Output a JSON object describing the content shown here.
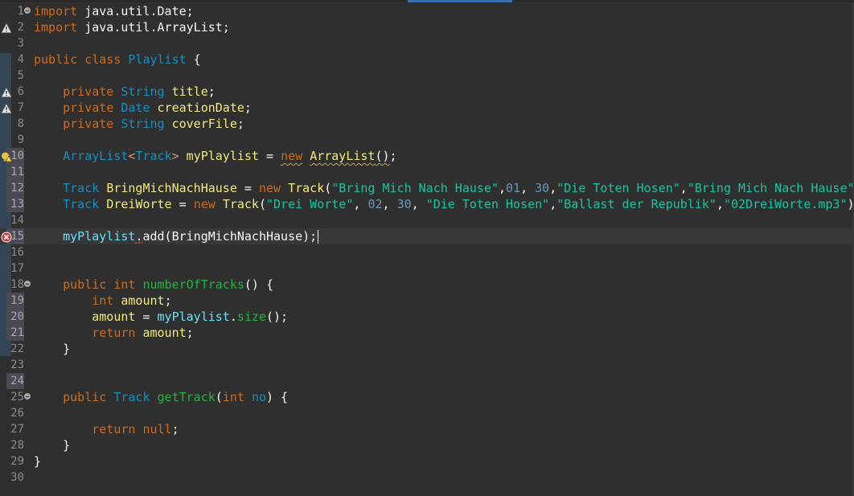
{
  "editor": {
    "language": "Java",
    "file_lines": [
      {
        "num": "1",
        "tokens": [
          [
            "k",
            "import"
          ],
          [
            "p",
            " java.util.Date;"
          ]
        ]
      },
      {
        "num": "2",
        "tokens": [
          [
            "k",
            "import"
          ],
          [
            "p",
            " java.util.ArrayList;"
          ]
        ]
      },
      {
        "num": "3",
        "tokens": []
      },
      {
        "num": "4",
        "tokens": [
          [
            "k",
            "public"
          ],
          [
            "p",
            " "
          ],
          [
            "k",
            "class"
          ],
          [
            "p",
            " "
          ],
          [
            "t",
            "Playlist"
          ],
          [
            "p",
            " {"
          ]
        ]
      },
      {
        "num": "5",
        "tokens": []
      },
      {
        "num": "6",
        "tokens": [
          [
            "p",
            "    "
          ],
          [
            "k",
            "private"
          ],
          [
            "p",
            " "
          ],
          [
            "t",
            "String"
          ],
          [
            "p",
            " "
          ],
          [
            "v",
            "title"
          ],
          [
            "p",
            ";"
          ]
        ]
      },
      {
        "num": "7",
        "tokens": [
          [
            "p",
            "    "
          ],
          [
            "k",
            "private"
          ],
          [
            "p",
            " "
          ],
          [
            "t",
            "Date"
          ],
          [
            "p",
            " "
          ],
          [
            "v",
            "creationDate"
          ],
          [
            "p",
            ";"
          ]
        ]
      },
      {
        "num": "8",
        "tokens": [
          [
            "p",
            "    "
          ],
          [
            "k",
            "private"
          ],
          [
            "p",
            " "
          ],
          [
            "t",
            "String"
          ],
          [
            "p",
            " "
          ],
          [
            "v",
            "coverFile"
          ],
          [
            "p",
            ";"
          ]
        ]
      },
      {
        "num": "9",
        "tokens": []
      },
      {
        "num": "10",
        "tokens": [
          [
            "p",
            "    "
          ],
          [
            "t",
            "ArrayList"
          ],
          [
            "g",
            "<"
          ],
          [
            "t",
            "Track"
          ],
          [
            "g",
            ">"
          ],
          [
            "p",
            " "
          ],
          [
            "v",
            "myPlaylist"
          ],
          [
            "p",
            " = "
          ],
          [
            "kw",
            "new"
          ],
          [
            "p",
            " "
          ],
          [
            "tw",
            "ArrayList"
          ],
          [
            "pw",
            "()"
          ],
          [
            "p",
            ";"
          ]
        ]
      },
      {
        "num": "11",
        "tokens": []
      },
      {
        "num": "12",
        "tokens": [
          [
            "p",
            "    "
          ],
          [
            "t",
            "Track"
          ],
          [
            "p",
            " "
          ],
          [
            "v",
            "BringMichNachHause"
          ],
          [
            "p",
            " = "
          ],
          [
            "k",
            "new"
          ],
          [
            "p",
            " "
          ],
          [
            "v",
            "Track"
          ],
          [
            "p",
            "("
          ],
          [
            "s",
            "\"Bring Mich Nach Hause\""
          ],
          [
            "p",
            ","
          ],
          [
            "n",
            "01"
          ],
          [
            "p",
            ", "
          ],
          [
            "n",
            "30"
          ],
          [
            "p",
            ","
          ],
          [
            "s",
            "\"Die Toten Hosen\""
          ],
          [
            "p",
            ","
          ],
          [
            "s",
            "\"Bring Mich Nach Hause\""
          ]
        ]
      },
      {
        "num": "13",
        "tokens": [
          [
            "p",
            "    "
          ],
          [
            "t",
            "Track"
          ],
          [
            "p",
            " "
          ],
          [
            "v",
            "DreiWorte"
          ],
          [
            "p",
            " = "
          ],
          [
            "k",
            "new"
          ],
          [
            "p",
            " "
          ],
          [
            "v",
            "Track"
          ],
          [
            "p",
            "("
          ],
          [
            "s",
            "\"Drei Worte\""
          ],
          [
            "p",
            ", "
          ],
          [
            "n",
            "02"
          ],
          [
            "p",
            ", "
          ],
          [
            "n",
            "30"
          ],
          [
            "p",
            ", "
          ],
          [
            "s",
            "\"Die Toten Hosen\""
          ],
          [
            "p",
            ","
          ],
          [
            "s",
            "\"Ballast der Republik\""
          ],
          [
            "p",
            ","
          ],
          [
            "s",
            "\"02DreiWorte.mp3\""
          ],
          [
            "p",
            ")"
          ]
        ]
      },
      {
        "num": "14",
        "tokens": []
      },
      {
        "num": "15",
        "tokens": [
          [
            "p",
            "    "
          ],
          [
            "f",
            "myPlaylist"
          ],
          [
            "e",
            "."
          ],
          [
            "p",
            "add(BringMichNachHause);"
          ]
        ]
      },
      {
        "num": "16",
        "tokens": []
      },
      {
        "num": "17",
        "tokens": []
      },
      {
        "num": "18",
        "tokens": [
          [
            "p",
            "    "
          ],
          [
            "k",
            "public"
          ],
          [
            "p",
            " "
          ],
          [
            "k",
            "int"
          ],
          [
            "p",
            " "
          ],
          [
            "m",
            "numberOfTracks"
          ],
          [
            "p",
            "() {"
          ]
        ]
      },
      {
        "num": "19",
        "tokens": [
          [
            "p",
            "        "
          ],
          [
            "k",
            "int"
          ],
          [
            "p",
            " "
          ],
          [
            "v",
            "amount"
          ],
          [
            "p",
            ";"
          ]
        ]
      },
      {
        "num": "20",
        "tokens": [
          [
            "p",
            "        "
          ],
          [
            "v",
            "amount"
          ],
          [
            "p",
            " = "
          ],
          [
            "f",
            "myPlaylist"
          ],
          [
            "p",
            "."
          ],
          [
            "m",
            "size"
          ],
          [
            "p",
            "();"
          ]
        ]
      },
      {
        "num": "21",
        "tokens": [
          [
            "p",
            "        "
          ],
          [
            "k",
            "return"
          ],
          [
            "p",
            " "
          ],
          [
            "v",
            "amount"
          ],
          [
            "p",
            ";"
          ]
        ]
      },
      {
        "num": "22",
        "tokens": [
          [
            "p",
            "    }"
          ]
        ]
      },
      {
        "num": "23",
        "tokens": []
      },
      {
        "num": "24",
        "tokens": []
      },
      {
        "num": "25",
        "tokens": [
          [
            "p",
            "    "
          ],
          [
            "k",
            "public"
          ],
          [
            "p",
            " "
          ],
          [
            "t",
            "Track"
          ],
          [
            "p",
            " "
          ],
          [
            "m",
            "getTrack"
          ],
          [
            "p",
            "("
          ],
          [
            "k",
            "int"
          ],
          [
            "p",
            " "
          ],
          [
            "t",
            "no"
          ],
          [
            "p",
            ") {"
          ]
        ]
      },
      {
        "num": "26",
        "tokens": []
      },
      {
        "num": "27",
        "tokens": [
          [
            "p",
            "        "
          ],
          [
            "k",
            "return"
          ],
          [
            "p",
            " "
          ],
          [
            "k",
            "null"
          ],
          [
            "p",
            ";"
          ]
        ]
      },
      {
        "num": "28",
        "tokens": [
          [
            "p",
            "    }"
          ]
        ]
      },
      {
        "num": "29",
        "tokens": [
          [
            "p",
            "}"
          ]
        ]
      },
      {
        "num": "30",
        "tokens": []
      }
    ],
    "fold_lines": [
      "1",
      "18",
      "25"
    ],
    "changed_lines": [
      "10",
      "11",
      "12",
      "13",
      "15",
      "19",
      "20",
      "21",
      "24"
    ],
    "current_line": "15",
    "markers": {
      "2": "warning-icon",
      "6": "warning-icon",
      "7": "warning-icon",
      "10": "quickfix-warning-icon",
      "15": "error-icon"
    },
    "colors": {
      "background": "#2f2f2f",
      "keyword": "#cc6c1d",
      "type": "#1290c3",
      "string": "#17c6a3",
      "field": "#66e1f8",
      "method": "#1eb540",
      "number": "#6897bb",
      "variable": "#f3ec79",
      "error": "#ff4a4a",
      "warning": "#d2a640"
    }
  }
}
